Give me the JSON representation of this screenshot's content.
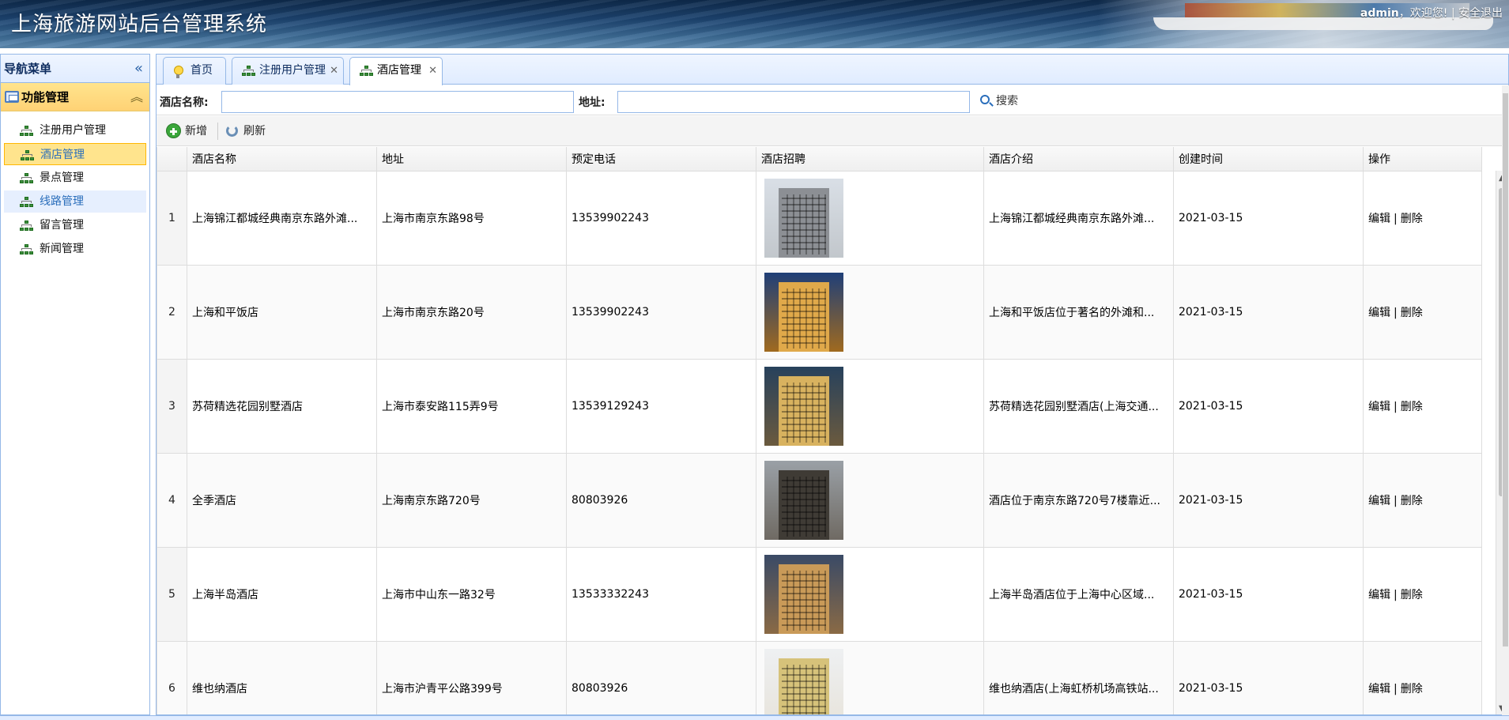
{
  "header": {
    "title": "上海旅游网站后台管理系统",
    "username": "admin",
    "welcome": "，欢迎您!",
    "divider": "|",
    "logout": "安全退出"
  },
  "sidebar": {
    "title": "导航菜单",
    "collapse_icon": "double-chevron-left-icon",
    "group": "功能管理",
    "items": [
      {
        "label": "注册用户管理",
        "state": "normal"
      },
      {
        "label": "酒店管理",
        "state": "active"
      },
      {
        "label": "景点管理",
        "state": "normal"
      },
      {
        "label": "线路管理",
        "state": "hover"
      },
      {
        "label": "留言管理",
        "state": "normal"
      },
      {
        "label": "新闻管理",
        "state": "normal"
      }
    ]
  },
  "tabs": [
    {
      "label": "首页",
      "icon": "lightbulb-icon",
      "closable": false
    },
    {
      "label": "注册用户管理",
      "icon": "tree-icon",
      "closable": true
    },
    {
      "label": "酒店管理",
      "icon": "tree-icon",
      "closable": true,
      "selected": true
    }
  ],
  "search": {
    "name_label": "酒店名称:",
    "name_value": "",
    "address_label": "地址:",
    "address_value": "",
    "button": "搜索"
  },
  "toolbar": {
    "add": "新增",
    "refresh": "刷新"
  },
  "grid": {
    "columns": [
      "酒店名称",
      "地址",
      "预定电话",
      "酒店招聘",
      "酒店介绍",
      "创建时间",
      "操作"
    ],
    "edit": "编辑",
    "sep": "|",
    "delete": "删除",
    "rows": [
      {
        "no": "1",
        "name": "上海锦江都城经典南京东路外滩...",
        "address": "上海市南京东路98号",
        "phone": "13539902243",
        "intro": "上海锦江都城经典南京东路外滩...",
        "created": "2021-03-15"
      },
      {
        "no": "2",
        "name": "上海和平饭店",
        "address": "上海市南京东路20号",
        "phone": "13539902243",
        "intro": "上海和平饭店位于著名的外滩和...",
        "created": "2021-03-15"
      },
      {
        "no": "3",
        "name": "苏荷精选花园别墅酒店",
        "address": "上海市泰安路115弄9号",
        "phone": "13539129243",
        "intro": "苏荷精选花园别墅酒店(上海交通...",
        "created": "2021-03-15"
      },
      {
        "no": "4",
        "name": "全季酒店",
        "address": "上海南京东路720号",
        "phone": "80803926",
        "intro": "酒店位于南京东路720号7楼靠近...",
        "created": "2021-03-15"
      },
      {
        "no": "5",
        "name": "上海半岛酒店",
        "address": "上海市中山东一路32号",
        "phone": "13533332243",
        "intro": "上海半岛酒店位于上海中心区域...",
        "created": "2021-03-15"
      },
      {
        "no": "6",
        "name": "维也纳酒店",
        "address": "上海市沪青平公路399号",
        "phone": "80803926",
        "intro": "维也纳酒店(上海虹桥机场高铁站...",
        "created": "2021-03-15"
      }
    ]
  },
  "colors": {
    "accent_border": "#95b8e7",
    "active_item": "#ffe48d",
    "link_blue": "#2a6ebb"
  }
}
